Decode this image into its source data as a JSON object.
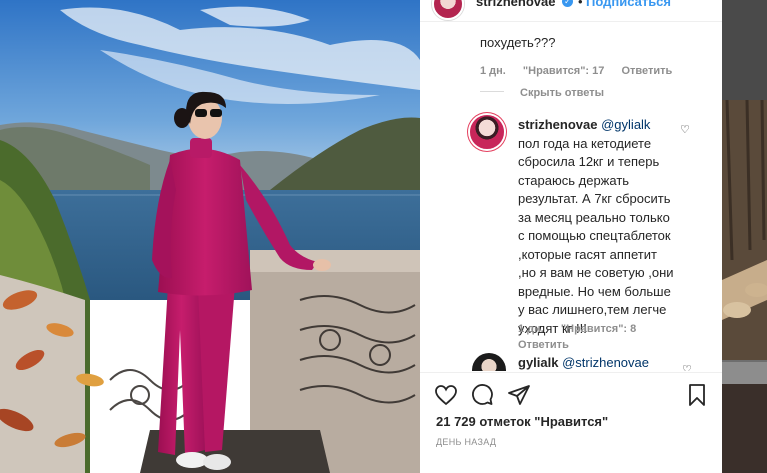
{
  "header": {
    "username": "strizhenovae",
    "dot": "•",
    "follow_label": "Подписаться",
    "more": "•••"
  },
  "comments": {
    "prev_comment_tail": "похудеть???",
    "prev_meta": {
      "time": "1 дн.",
      "likes": "\"Нравится\": 17",
      "reply": "Ответить"
    },
    "hide_replies": "Скрыть ответы",
    "reply1": {
      "username": "strizhenovae",
      "mention": "@gylialk",
      "text_lines": [
        "пол года на кетодиете",
        "сбросила 12кг и теперь",
        "стараюсь держать",
        "результат. А 7кг сбросить",
        "за месяц реально только",
        "с помощью спецтаблеток",
        ",которые гасят аппетит",
        ",но я вам не советую ,они",
        "вредные. Но чем больше",
        "у вас лишнего,тем легче",
        "уходят кг !!!"
      ],
      "meta": {
        "time": "1 дн.",
        "likes": "\"Нравится\": 8",
        "reply": "Ответить"
      }
    },
    "reply2": {
      "username": "gylialk",
      "mention": "@strizhenovae"
    }
  },
  "footer": {
    "likes_count": "21 729 отметок \"Нравится\"",
    "date": "ДЕНЬ НАЗАД"
  },
  "icons": {
    "like": "heart-icon",
    "comment": "comment-icon",
    "share": "share-icon",
    "save": "bookmark-icon",
    "verified": "verified-badge-icon"
  },
  "colors": {
    "accent": "#3897f0",
    "muted": "#8e8e8e",
    "text": "#262626",
    "outfit": "#b5135f"
  }
}
